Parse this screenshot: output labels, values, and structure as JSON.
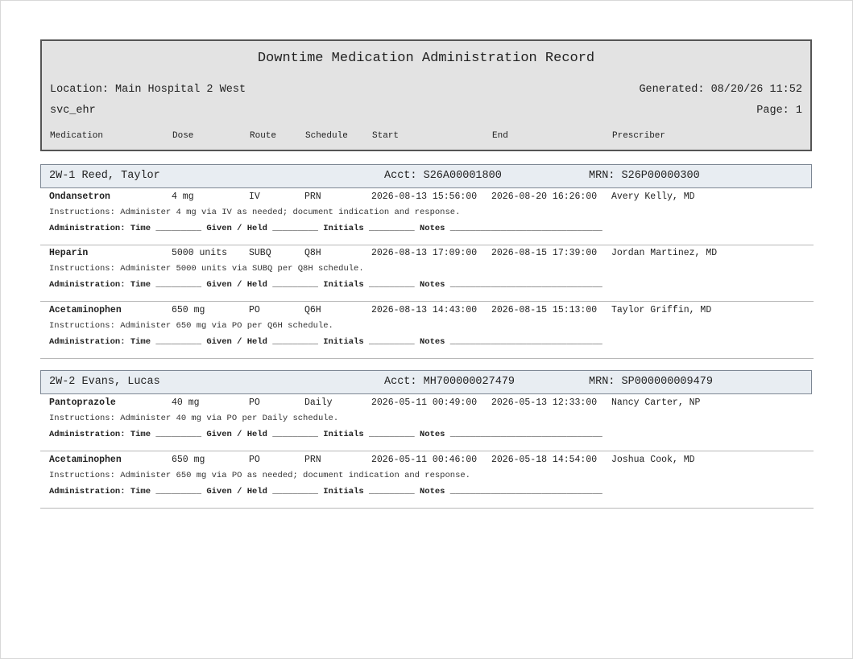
{
  "header": {
    "title": "Downtime Medication Administration Record",
    "location": "Location: Main Hospital 2 West",
    "generated": "Generated: 08/20/26 11:52",
    "user": "svc_ehr",
    "page": "Page: 1",
    "columns": {
      "medication": "Medication",
      "dose": "Dose",
      "route": "Route",
      "schedule": "Schedule",
      "start": "Start",
      "end": "End",
      "prescriber": "Prescriber"
    }
  },
  "admin_line": "Administration: Time _________ Given / Held _________ Initials _________ Notes ______________________________",
  "patients": [
    {
      "bed_name": "2W-1  Reed, Taylor",
      "acct": "Acct: S26A00001800",
      "mrn": "MRN: S26P00000300",
      "meds": [
        {
          "name": "Ondansetron",
          "dose": "4 mg",
          "route": "IV",
          "schedule": "PRN",
          "start": "2026-08-13 15:56:00",
          "end": "2026-08-20 16:26:00",
          "prescriber": "Avery Kelly, MD",
          "instructions": "Instructions: Administer 4 mg via IV as needed; document indication and response."
        },
        {
          "name": "Heparin",
          "dose": "5000 units",
          "route": "SUBQ",
          "schedule": "Q8H",
          "start": "2026-08-13 17:09:00",
          "end": "2026-08-15 17:39:00",
          "prescriber": "Jordan Martinez, MD",
          "instructions": "Instructions: Administer 5000 units via SUBQ per Q8H schedule."
        },
        {
          "name": "Acetaminophen",
          "dose": "650 mg",
          "route": "PO",
          "schedule": "Q6H",
          "start": "2026-08-13 14:43:00",
          "end": "2026-08-15 15:13:00",
          "prescriber": "Taylor Griffin, MD",
          "instructions": "Instructions: Administer 650 mg via PO per Q6H schedule."
        }
      ]
    },
    {
      "bed_name": "2W-2  Evans, Lucas",
      "acct": "Acct: MH700000027479",
      "mrn": "MRN: SP000000009479",
      "meds": [
        {
          "name": "Pantoprazole",
          "dose": "40 mg",
          "route": "PO",
          "schedule": "Daily",
          "start": "2026-05-11 00:49:00",
          "end": "2026-05-13 12:33:00",
          "prescriber": "Nancy Carter, NP",
          "instructions": "Instructions: Administer 40 mg via PO per Daily schedule."
        },
        {
          "name": "Acetaminophen",
          "dose": "650 mg",
          "route": "PO",
          "schedule": "PRN",
          "start": "2026-05-11 00:46:00",
          "end": "2026-05-18 14:54:00",
          "prescriber": "Joshua Cook, MD",
          "instructions": "Instructions: Administer 650 mg via PO as needed; document indication and response."
        }
      ]
    }
  ]
}
